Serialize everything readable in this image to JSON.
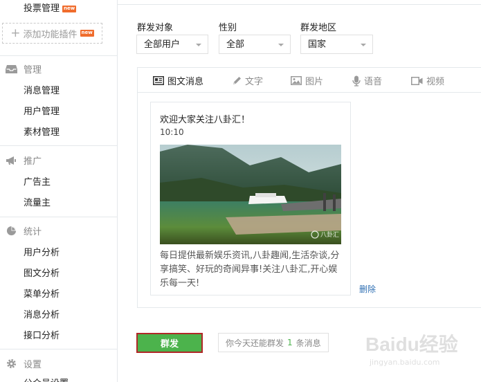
{
  "sidebar": {
    "top_item": {
      "label": "投票管理",
      "badge": "new"
    },
    "add_plugin": {
      "label": "添加功能插件",
      "badge": "new"
    },
    "groups": [
      {
        "title": "管理",
        "icon": "inbox-icon",
        "items": [
          "消息管理",
          "用户管理",
          "素材管理"
        ]
      },
      {
        "title": "推广",
        "icon": "megaphone-icon",
        "items": [
          "广告主",
          "流量主"
        ]
      },
      {
        "title": "统计",
        "icon": "pie-chart-icon",
        "items": [
          "用户分析",
          "图文分析",
          "菜单分析",
          "消息分析",
          "接口分析"
        ]
      },
      {
        "title": "设置",
        "icon": "gear-icon",
        "items": [
          "公众号设置"
        ]
      }
    ]
  },
  "filters": {
    "target": {
      "label": "群发对象",
      "value": "全部用户"
    },
    "gender": {
      "label": "性别",
      "value": "全部"
    },
    "region": {
      "label": "群发地区",
      "value": "国家"
    }
  },
  "tabs": [
    {
      "label": "图文消息",
      "icon": "news-icon",
      "active": true
    },
    {
      "label": "文字",
      "icon": "pencil-icon",
      "active": false
    },
    {
      "label": "图片",
      "icon": "image-icon",
      "active": false
    },
    {
      "label": "语音",
      "icon": "microphone-icon",
      "active": false
    },
    {
      "label": "视频",
      "icon": "video-icon",
      "active": false
    }
  ],
  "card": {
    "title": "欢迎大家关注八卦汇！",
    "time": "10:10",
    "image_watermark": "八卦汇",
    "description": "每日提供最新娱乐资讯,八卦趣闻,生活杂谈,分享搞笑、好玩的奇闻异事!关注八卦汇,开心娱乐每一天!"
  },
  "delete_label": "删除",
  "send_button": "群发",
  "send_tip": {
    "prefix": "你今天还能群发",
    "count": "1",
    "suffix": "条消息"
  },
  "watermark": {
    "text": "Baidu经验",
    "url": "jingyan.baidu.com"
  },
  "colors": {
    "accent_green": "#4cb34c",
    "link_blue": "#2f6fb3",
    "badge_orange": "#f06c2c",
    "highlight_red": "#b02727"
  }
}
